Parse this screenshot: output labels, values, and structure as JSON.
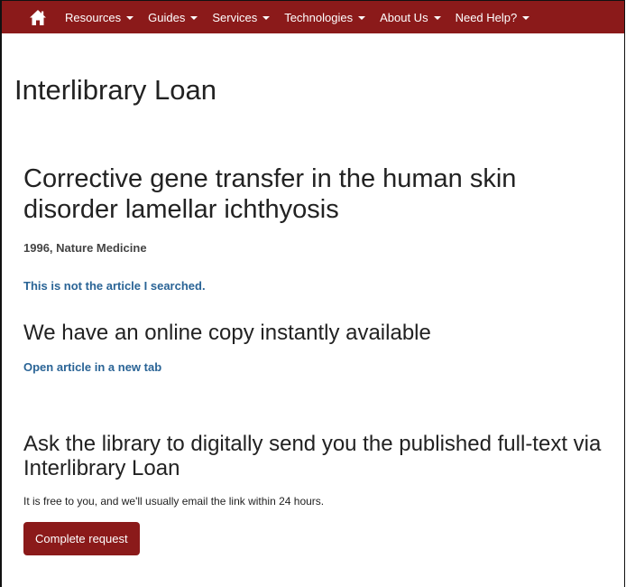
{
  "navbar": {
    "home_icon": "home-icon",
    "items": [
      {
        "label": "Resources"
      },
      {
        "label": "Guides"
      },
      {
        "label": "Services"
      },
      {
        "label": "Technologies"
      },
      {
        "label": "About Us"
      },
      {
        "label": "Need Help?"
      }
    ],
    "background": "#8b1a1a"
  },
  "page": {
    "title": "Interlibrary Loan"
  },
  "article": {
    "title": "Corrective gene transfer in the human skin disorder lamellar ichthyosis",
    "meta": "1996, Nature Medicine",
    "not_article_link": "This is not the article I searched."
  },
  "online": {
    "heading": "We have an online copy instantly available",
    "open_link": "Open article in a new tab"
  },
  "ill": {
    "heading": "Ask the library to digitally send you the published full-text via Interlibrary Loan",
    "note": "It is free to you, and we'll usually email the link within 24 hours.",
    "button_label": "Complete request"
  },
  "colors": {
    "accent": "#8b1a1a",
    "link": "#2a6496"
  }
}
